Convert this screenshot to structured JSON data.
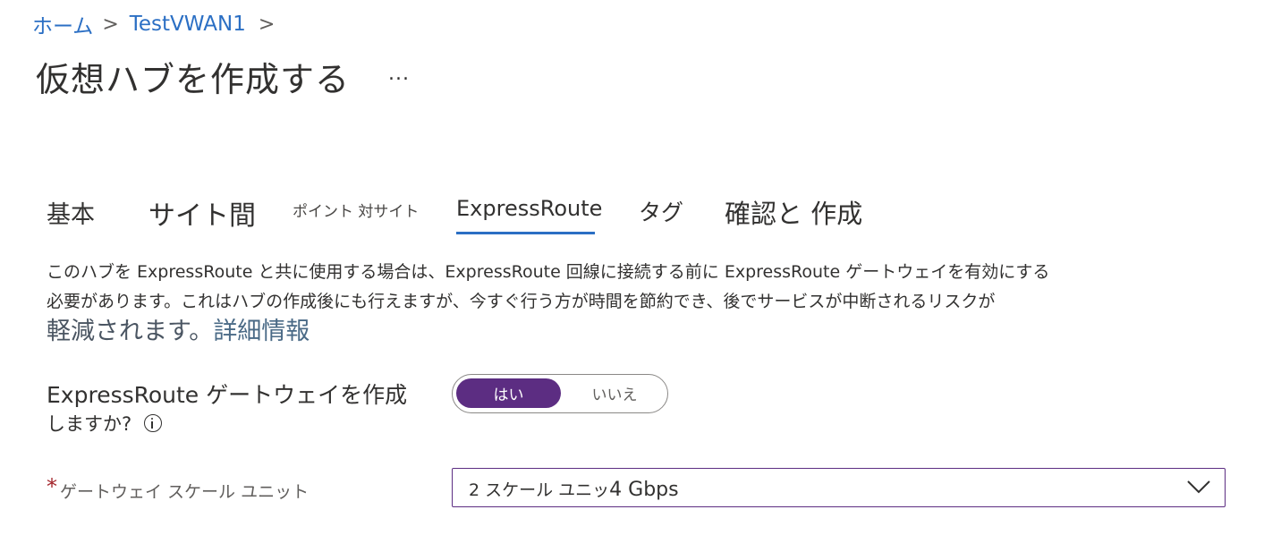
{
  "breadcrumb": {
    "home": "ホーム",
    "separator": ">",
    "parent": "TestVWAN1",
    "end_separator": ">"
  },
  "page": {
    "title": "仮想ハブを作成する",
    "more": "..."
  },
  "tabs": [
    {
      "label": "基本",
      "active": false
    },
    {
      "label": "サイト間",
      "active": false
    },
    {
      "label": "ポイント 対サイト",
      "active": false
    },
    {
      "label": "ExpressRoute",
      "active": true
    },
    {
      "label": "タグ",
      "active": false
    },
    {
      "label": "確認と 作成",
      "active": false
    }
  ],
  "description": {
    "line1": "このハブを ExpressRoute と共に使用する場合は、ExpressRoute 回線に接続する前に ExpressRoute ゲートウェイを有効にする",
    "line2": "必要があります。これはハブの作成後にも行えますが、今すぐ行う方が時間を節約でき、後でサービスが中断されるリスクが",
    "line3": "軽減されます。",
    "link": "詳細情報"
  },
  "gateway_question": {
    "label_line1": "ExpressRoute ゲートウェイを作成",
    "label_line2": "しますか?",
    "info_icon": "info-icon",
    "options": [
      "はい",
      "いいえ"
    ],
    "selected": "はい"
  },
  "scale_units": {
    "required_marker": "*",
    "label": "ゲートウェイ スケール ユニット",
    "value_units": "2 スケール ユニッ",
    "value_bandwidth": "4 Gbps",
    "dropdown_icon": "chevron-down-icon"
  },
  "colors": {
    "accent_purple": "#5c2d82",
    "tab_underline": "#2b6fc4",
    "link": "#2b6fc4",
    "required": "#a4262c"
  }
}
